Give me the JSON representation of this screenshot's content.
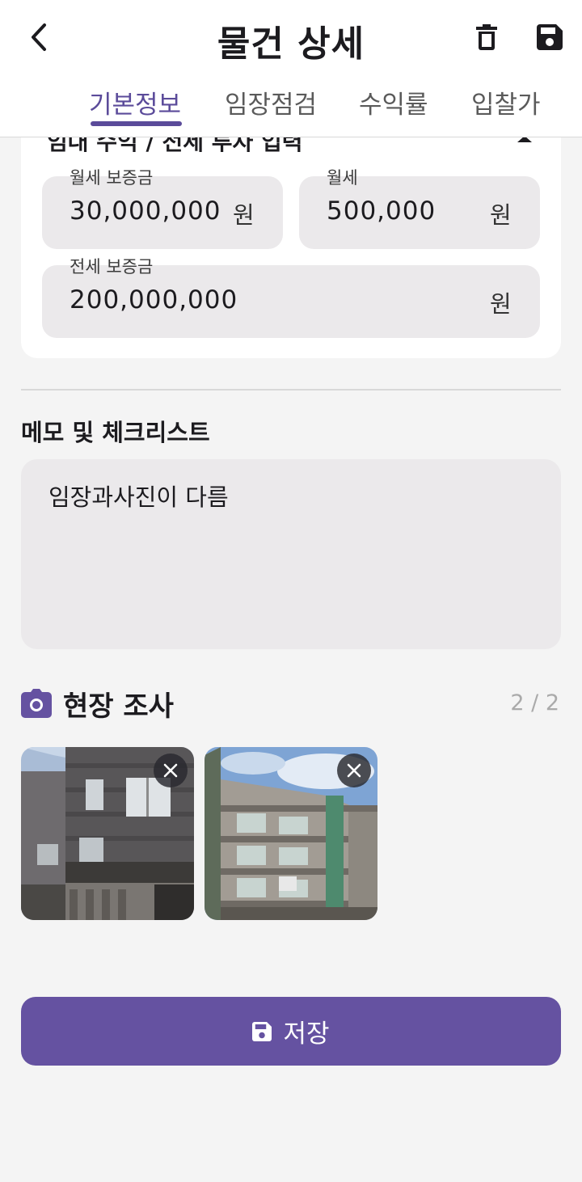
{
  "header": {
    "title": "물건 상세",
    "back_icon": "chevron-left-icon",
    "delete_icon": "trash-icon",
    "save_icon": "floppy-disk-icon"
  },
  "tabs": [
    {
      "label": "기본정보",
      "active": true
    },
    {
      "label": "임장점검",
      "active": false
    },
    {
      "label": "수익률",
      "active": false
    },
    {
      "label": "입찰가",
      "active": false
    }
  ],
  "rent_section": {
    "heading": "임대 수익 / 전세 투자 입력",
    "collapse_icon": "caret-up-icon",
    "fields": {
      "monthly_deposit": {
        "label": "월세 보증금",
        "value": "30,000,000",
        "unit": "원"
      },
      "monthly_rent": {
        "label": "월세",
        "value": "500,000",
        "unit": "원"
      },
      "jeonse_deposit": {
        "label": "전세 보증금",
        "value": "200,000,000",
        "unit": "원"
      }
    }
  },
  "memo": {
    "title": "메모 및 체크리스트",
    "text": "임장과사진이 다름"
  },
  "survey": {
    "title": "현장 조사",
    "icon": "camera-icon",
    "count": "2 / 2",
    "photos": [
      {
        "name": "building-photo-1",
        "remove_icon": "close-icon"
      },
      {
        "name": "building-photo-2",
        "remove_icon": "close-icon"
      }
    ]
  },
  "save_button": {
    "label": "저장",
    "icon": "floppy-disk-icon"
  },
  "colors": {
    "accent": "#6552a1",
    "tab_active": "#5b4b9a",
    "field_bg": "#ebe9eb",
    "page_bg": "#f4f4f4"
  }
}
